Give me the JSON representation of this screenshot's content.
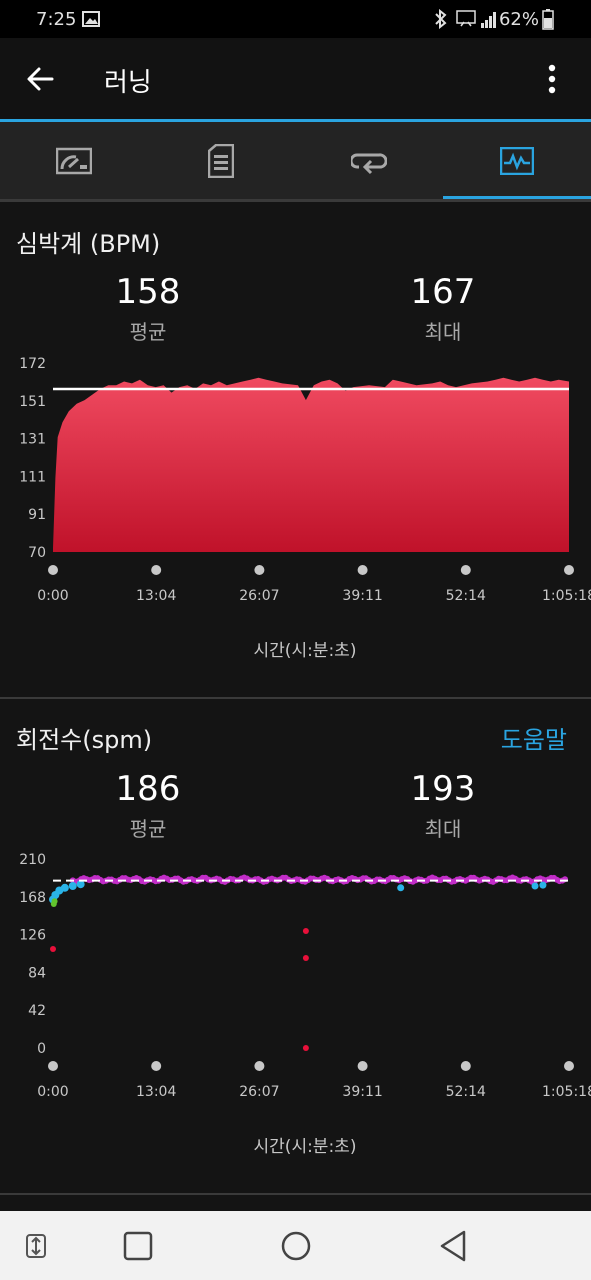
{
  "status_bar": {
    "time": "7:25",
    "battery": "62%"
  },
  "app_bar": {
    "title": "러닝"
  },
  "tabs": [
    {
      "name": "gauge",
      "active": false
    },
    {
      "name": "details",
      "active": false
    },
    {
      "name": "laps",
      "active": false
    },
    {
      "name": "charts",
      "active": true
    }
  ],
  "heart_rate": {
    "title": "심박계 (BPM)",
    "avg_value": "158",
    "avg_label": "평균",
    "max_value": "167",
    "max_label": "최대"
  },
  "cadence": {
    "title": "회전수(spm)",
    "help": "도움말",
    "avg_value": "186",
    "avg_label": "평균",
    "max_value": "193",
    "max_label": "최대"
  },
  "colors": {
    "accent": "#2aa4e0",
    "hr_fill_top": "#f04a60",
    "hr_fill_bottom": "#c0122a",
    "cadence_purple": "#c22dc8",
    "cadence_blue": "#2ab4e8",
    "cadence_green": "#62c42e",
    "cadence_red": "#e8103a"
  },
  "chart_data": [
    {
      "type": "area",
      "xlabel": "시간(시:분:초)",
      "ylabel": "",
      "ylim": [
        70,
        172
      ],
      "yticks": [
        "172",
        "151",
        "131",
        "111",
        "91",
        "70"
      ],
      "xticks": [
        "0:00",
        "13:04",
        "26:07",
        "39:11",
        "52:14",
        "1:05:18"
      ],
      "x_max_min": 65.3,
      "avg_line": 158,
      "points": [
        [
          0,
          72
        ],
        [
          0.3,
          110
        ],
        [
          0.6,
          132
        ],
        [
          1.2,
          140
        ],
        [
          2,
          146
        ],
        [
          3,
          150
        ],
        [
          4,
          152
        ],
        [
          5,
          155
        ],
        [
          6,
          158
        ],
        [
          7,
          160
        ],
        [
          8,
          160
        ],
        [
          9,
          162
        ],
        [
          10,
          161
        ],
        [
          11,
          163
        ],
        [
          12,
          160
        ],
        [
          13,
          159
        ],
        [
          14,
          160
        ],
        [
          15,
          156
        ],
        [
          16,
          159
        ],
        [
          17,
          160
        ],
        [
          18,
          158
        ],
        [
          19,
          161
        ],
        [
          20,
          160
        ],
        [
          21,
          162
        ],
        [
          22,
          160
        ],
        [
          23,
          161
        ],
        [
          24,
          162
        ],
        [
          25,
          163
        ],
        [
          26,
          164
        ],
        [
          27,
          163
        ],
        [
          28,
          162
        ],
        [
          29,
          161
        ],
        [
          31,
          160
        ],
        [
          32,
          152
        ],
        [
          33,
          160
        ],
        [
          34,
          162
        ],
        [
          35,
          163
        ],
        [
          36,
          161
        ],
        [
          37,
          157
        ],
        [
          38,
          159
        ],
        [
          40,
          160
        ],
        [
          42,
          159
        ],
        [
          43,
          163
        ],
        [
          44,
          162
        ],
        [
          45,
          161
        ],
        [
          46,
          160
        ],
        [
          48,
          161
        ],
        [
          49,
          162
        ],
        [
          50,
          160
        ],
        [
          51,
          159
        ],
        [
          52,
          160
        ],
        [
          53,
          161
        ],
        [
          55,
          162
        ],
        [
          56,
          163
        ],
        [
          57,
          164
        ],
        [
          58,
          163
        ],
        [
          59,
          162
        ],
        [
          60,
          163
        ],
        [
          61,
          164
        ],
        [
          62,
          163
        ],
        [
          63,
          162
        ],
        [
          64,
          163
        ],
        [
          65.3,
          162
        ]
      ]
    },
    {
      "type": "scatter",
      "xlabel": "시간(시:분:초)",
      "ylabel": "",
      "ylim": [
        0,
        210
      ],
      "yticks": [
        "210",
        "168",
        "126",
        "84",
        "42",
        "0"
      ],
      "xticks": [
        "0:00",
        "13:04",
        "26:07",
        "39:11",
        "52:14",
        "1:05:18"
      ],
      "x_max_min": 65.3,
      "avg_line": 186,
      "main_value": 187,
      "outliers": [
        [
          0,
          110
        ],
        [
          32,
          130
        ],
        [
          32,
          100
        ],
        [
          32,
          0
        ]
      ],
      "early_points": [
        [
          0,
          165
        ],
        [
          0.3,
          170
        ],
        [
          0.8,
          175
        ],
        [
          1.5,
          178
        ],
        [
          2.5,
          180
        ],
        [
          3.5,
          182
        ]
      ],
      "dips": [
        [
          44,
          178
        ],
        [
          61,
          180
        ],
        [
          62,
          181
        ]
      ]
    }
  ]
}
